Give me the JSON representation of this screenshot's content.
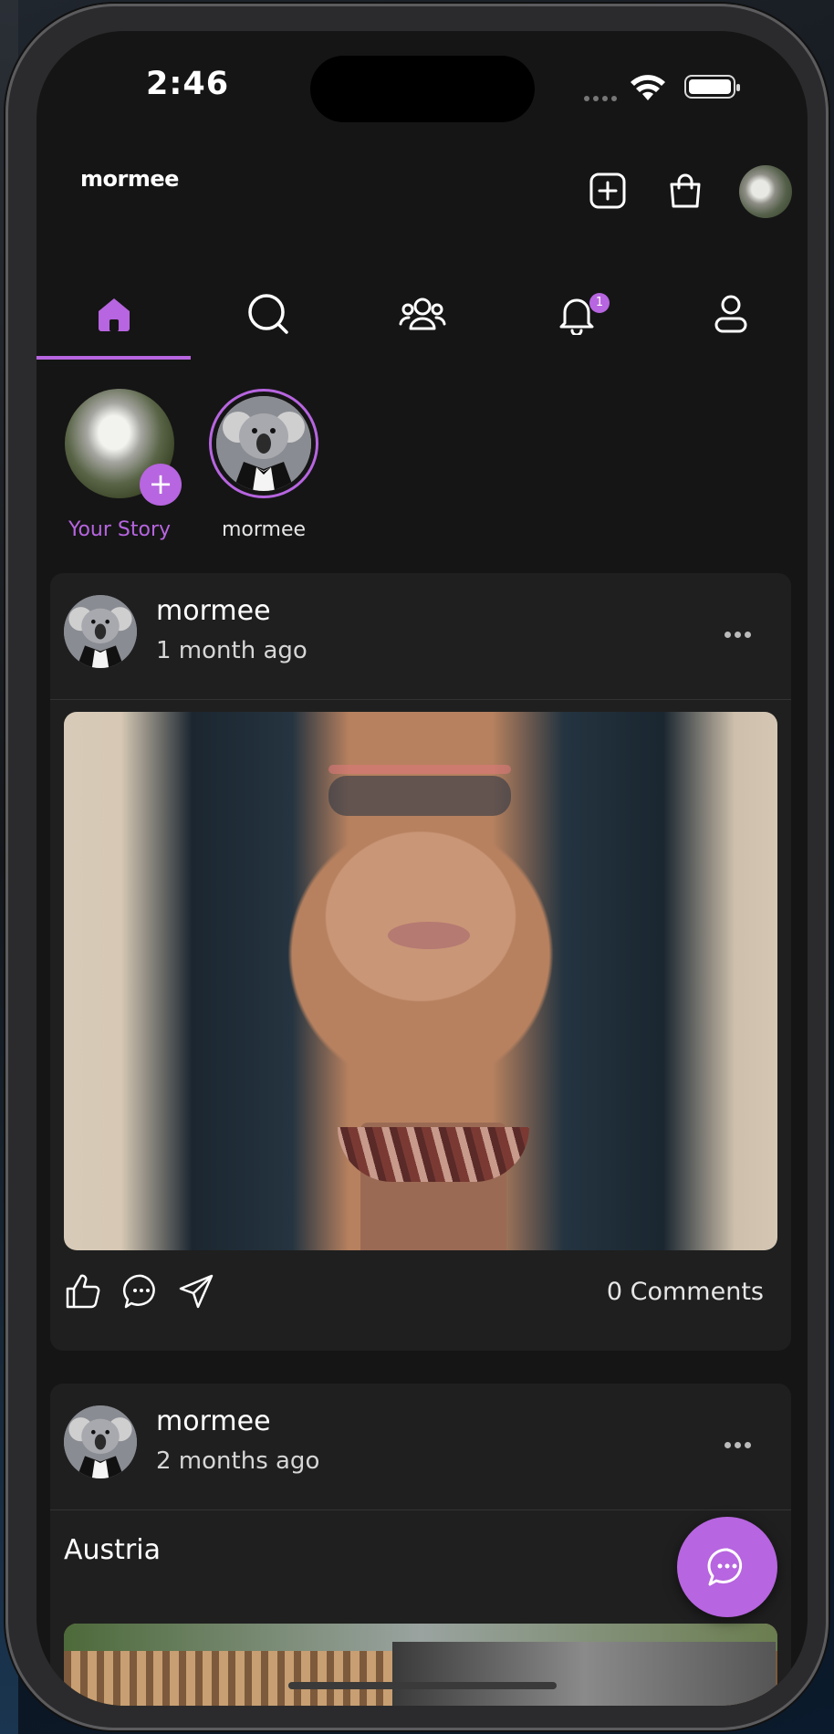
{
  "status_bar": {
    "time": "2:46"
  },
  "header": {
    "brand": "mormee",
    "create_label": "Create post",
    "shop_label": "Shop"
  },
  "tabs": [
    {
      "name": "home",
      "active": true
    },
    {
      "name": "search",
      "active": false
    },
    {
      "name": "groups",
      "active": false
    },
    {
      "name": "notifications",
      "active": false,
      "badge": "1"
    },
    {
      "name": "profile",
      "active": false
    }
  ],
  "stories": [
    {
      "label": "Your Story",
      "label_color": "#b765e0",
      "add_label": "+"
    },
    {
      "label": "mormee",
      "label_color": "#e6e6e6"
    }
  ],
  "posts": [
    {
      "author": "mormee",
      "time": "1 month ago",
      "comments": "0 Comments"
    },
    {
      "author": "mormee",
      "time": "2 months ago",
      "caption": "Austria"
    }
  ],
  "colors": {
    "accent": "#b765e0",
    "background": "#151515",
    "card": "#1f1f1f"
  },
  "icons": [
    "home-icon",
    "search-icon",
    "groups-icon",
    "bell-icon",
    "user-icon",
    "plus-square-icon",
    "bag-icon",
    "like-icon",
    "comment-icon",
    "share-icon",
    "more-icon",
    "chat-icon"
  ]
}
